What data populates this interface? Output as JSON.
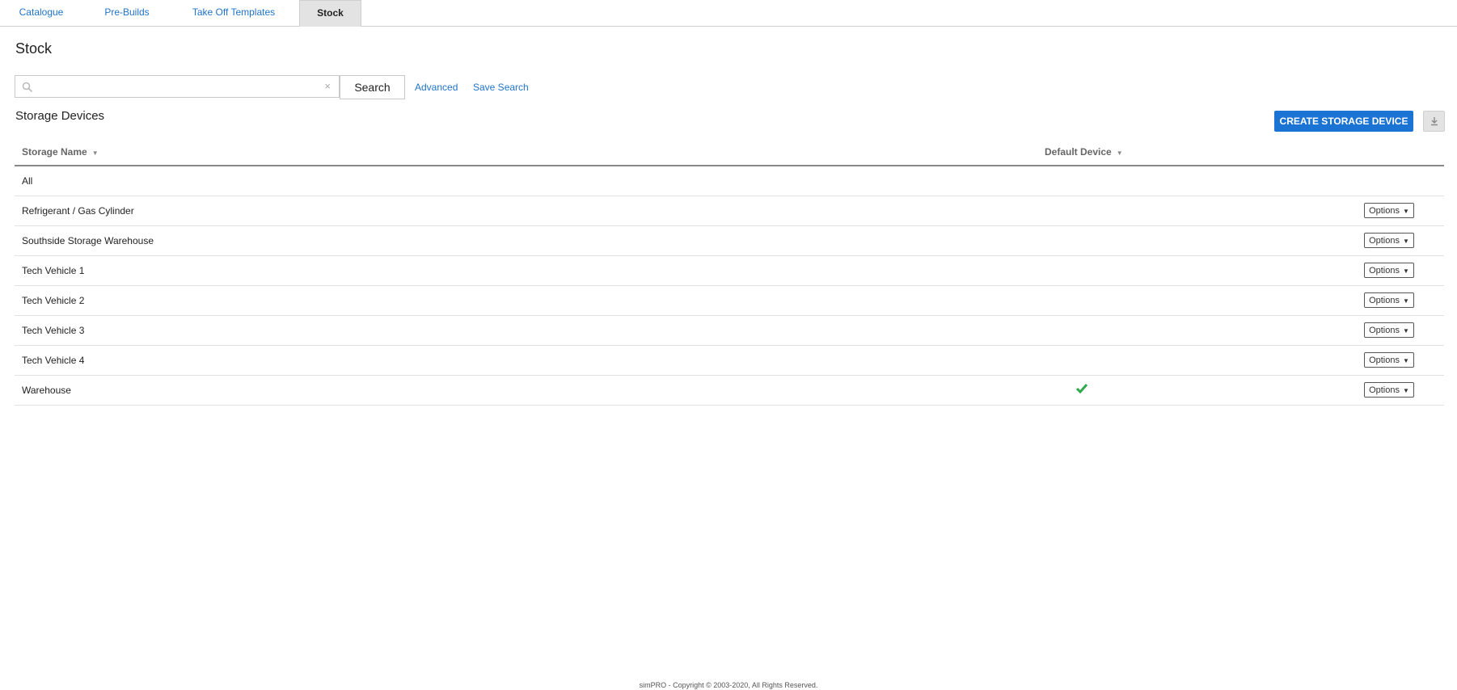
{
  "tabs": [
    {
      "label": "Catalogue",
      "active": false
    },
    {
      "label": "Pre-Builds",
      "active": false
    },
    {
      "label": "Take Off Templates",
      "active": false
    },
    {
      "label": "Stock",
      "active": true
    }
  ],
  "page_title": "Stock",
  "search": {
    "value": "",
    "placeholder": "",
    "button_label": "Search",
    "clear_symbol": "×",
    "links": {
      "advanced": "Advanced",
      "save_search": "Save Search"
    }
  },
  "section": {
    "title": "Storage Devices",
    "create_button": "CREATE STORAGE DEVICE",
    "download_icon": "download-icon"
  },
  "table": {
    "columns": {
      "name": "Storage Name",
      "default": "Default Device"
    },
    "sort_symbol": "▼",
    "rows": [
      {
        "name": "All",
        "default": false,
        "options": ""
      },
      {
        "name": "Refrigerant / Gas Cylinder",
        "default": false,
        "options": "Options"
      },
      {
        "name": "Southside Storage Warehouse",
        "default": false,
        "options": "Options"
      },
      {
        "name": "Tech Vehicle 1",
        "default": false,
        "options": "Options"
      },
      {
        "name": "Tech Vehicle 2",
        "default": false,
        "options": "Options"
      },
      {
        "name": "Tech Vehicle 3",
        "default": false,
        "options": "Options"
      },
      {
        "name": "Tech Vehicle 4",
        "default": false,
        "options": "Options"
      },
      {
        "name": "Warehouse",
        "default": true,
        "options": "Options"
      }
    ]
  },
  "footer": "simPRO - Copyright © 2003-2020, All Rights Reserved.",
  "colors": {
    "accent": "#1b73d3",
    "link": "#1f73c9",
    "check": "#2eaa4a",
    "active_tab_bg": "#e3e3e3"
  }
}
